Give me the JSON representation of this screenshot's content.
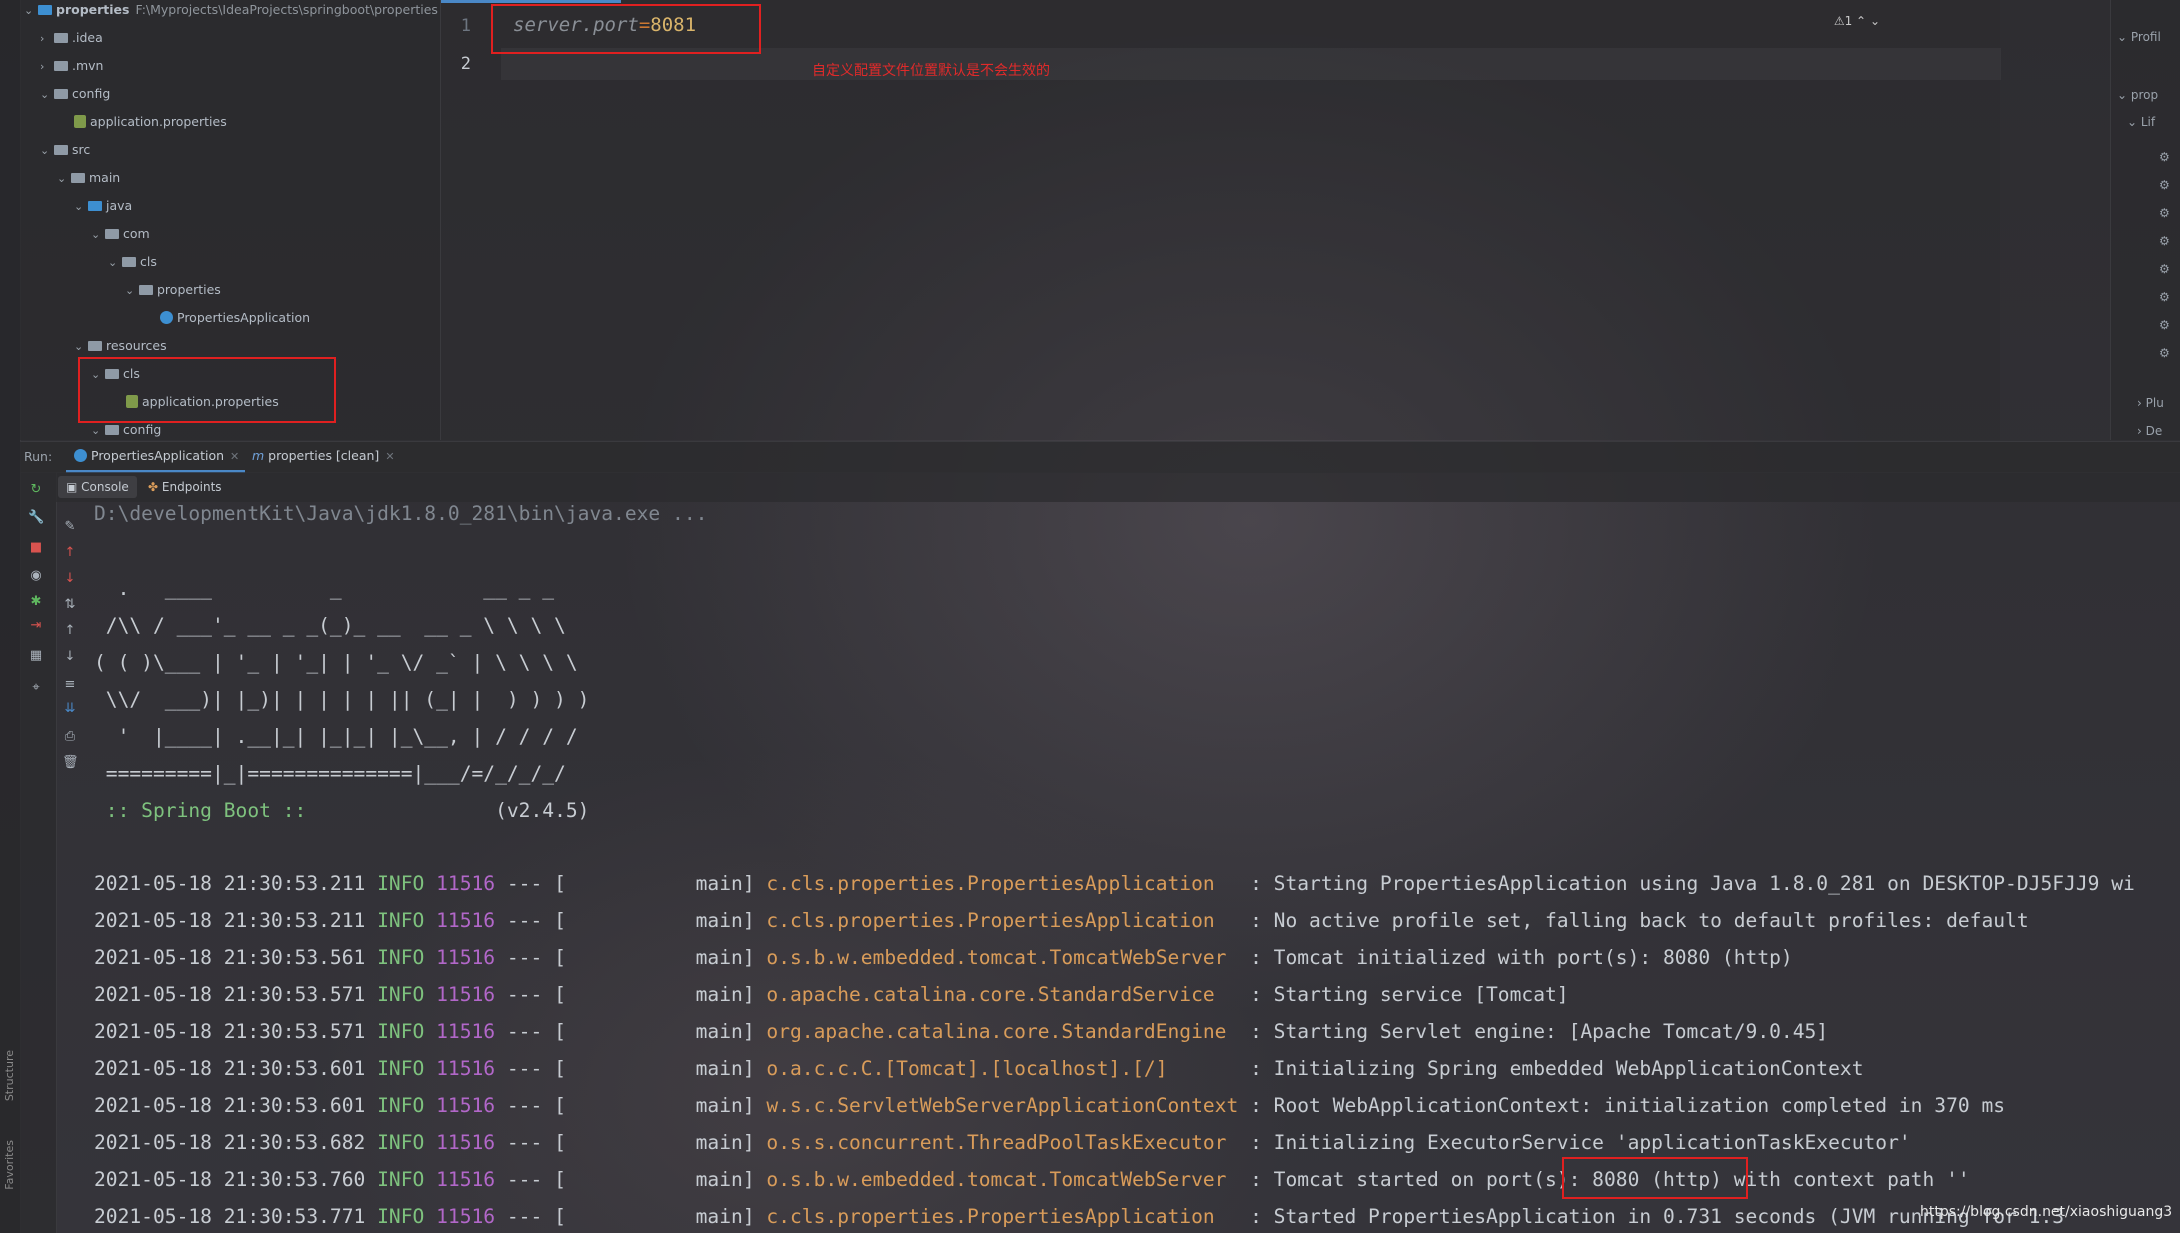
{
  "project": {
    "root_name": "properties",
    "root_path": "F:\\Myprojects\\IdeaProjects\\springboot\\properties",
    "items": [
      {
        "label": ".idea"
      },
      {
        "label": ".mvn"
      },
      {
        "label": "config"
      },
      {
        "label": "application.properties"
      },
      {
        "label": "src"
      },
      {
        "label": "main"
      },
      {
        "label": "java"
      },
      {
        "label": "com"
      },
      {
        "label": "cls"
      },
      {
        "label": "properties"
      },
      {
        "label": "PropertiesApplication"
      },
      {
        "label": "resources"
      },
      {
        "label": "cls"
      },
      {
        "label": "application.properties"
      },
      {
        "label": "config"
      }
    ]
  },
  "editor": {
    "line_numbers": [
      "1",
      "2"
    ],
    "code_key": "server.port",
    "code_eq": "=",
    "code_val": "8081",
    "note": "自定义配置文件位置默认是不会生效的",
    "warning": "⚠1"
  },
  "right_panel": {
    "items": [
      "Profil",
      "prop",
      "Lif",
      "Plu",
      "De"
    ]
  },
  "left_strip": {
    "labels": [
      "Structure",
      "Favorites"
    ]
  },
  "run": {
    "label": "Run:",
    "tabs": [
      "PropertiesApplication",
      "properties [clean]"
    ],
    "sub_tabs": [
      "Console",
      "Endpoints"
    ]
  },
  "console": {
    "cmd": "D:\\developmentKit\\Java\\jdk1.8.0_281\\bin\\java.exe ...",
    "banner": [
      "  .   ____          _            __ _ _",
      " /\\\\ / ___'_ __ _ _(_)_ __  __ _ \\ \\ \\ \\",
      "( ( )\\___ | '_ | '_| | '_ \\/ _` | \\ \\ \\ \\",
      " \\\\/  ___)| |_)| | | | | || (_| |  ) ) ) )",
      "  '  |____| .__|_| |_|_| |_\\__, | / / / /",
      " =========|_|==============|___/=/_/_/_/"
    ],
    "spring_label": " :: Spring Boot :: ",
    "spring_version": "               (v2.4.5)",
    "logs": [
      {
        "ts": "2021-05-18 21:30:53.211",
        "level": "INFO",
        "pid": "11516",
        "sep": "--- [           main]",
        "logger": "c.cls.properties.PropertiesApplication  ",
        "msg": " : Starting PropertiesApplication using Java 1.8.0_281 on DESKTOP-DJ5FJJ9 wi"
      },
      {
        "ts": "2021-05-18 21:30:53.211",
        "level": "INFO",
        "pid": "11516",
        "sep": "--- [           main]",
        "logger": "c.cls.properties.PropertiesApplication  ",
        "msg": " : No active profile set, falling back to default profiles: default"
      },
      {
        "ts": "2021-05-18 21:30:53.561",
        "level": "INFO",
        "pid": "11516",
        "sep": "--- [           main]",
        "logger": "o.s.b.w.embedded.tomcat.TomcatWebServer ",
        "msg": " : Tomcat initialized with port(s): 8080 (http)"
      },
      {
        "ts": "2021-05-18 21:30:53.571",
        "level": "INFO",
        "pid": "11516",
        "sep": "--- [           main]",
        "logger": "o.apache.catalina.core.StandardService  ",
        "msg": " : Starting service [Tomcat]"
      },
      {
        "ts": "2021-05-18 21:30:53.571",
        "level": "INFO",
        "pid": "11516",
        "sep": "--- [           main]",
        "logger": "org.apache.catalina.core.StandardEngine ",
        "msg": " : Starting Servlet engine: [Apache Tomcat/9.0.45]"
      },
      {
        "ts": "2021-05-18 21:30:53.601",
        "level": "INFO",
        "pid": "11516",
        "sep": "--- [           main]",
        "logger": "o.a.c.c.C.[Tomcat].[localhost].[/]      ",
        "msg": " : Initializing Spring embedded WebApplicationContext"
      },
      {
        "ts": "2021-05-18 21:30:53.601",
        "level": "INFO",
        "pid": "11516",
        "sep": "--- [           main]",
        "logger": "w.s.c.ServletWebServerApplicationContext",
        "msg": " : Root WebApplicationContext: initialization completed in 370 ms"
      },
      {
        "ts": "2021-05-18 21:30:53.682",
        "level": "INFO",
        "pid": "11516",
        "sep": "--- [           main]",
        "logger": "o.s.s.concurrent.ThreadPoolTaskExecutor ",
        "msg": " : Initializing ExecutorService 'applicationTaskExecutor'"
      },
      {
        "ts": "2021-05-18 21:30:53.760",
        "level": "INFO",
        "pid": "11516",
        "sep": "--- [           main]",
        "logger": "o.s.b.w.embedded.tomcat.TomcatWebServer ",
        "msg": " : Tomcat started on port(s): 8080 (http) with context path ''"
      },
      {
        "ts": "2021-05-18 21:30:53.771",
        "level": "INFO",
        "pid": "11516",
        "sep": "--- [           main]",
        "logger": "c.cls.properties.PropertiesApplication  ",
        "msg": " : Started PropertiesApplication in 0.731 seconds (JVM running for 1.3"
      }
    ]
  },
  "watermark": "https://blog.csdn.net/xiaoshiguang3"
}
